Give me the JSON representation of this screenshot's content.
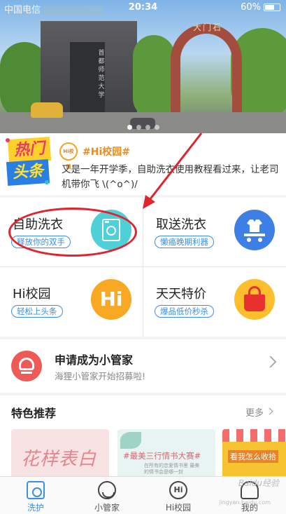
{
  "status_bar": {
    "carrier": "中国电信",
    "time": "20:34",
    "battery": "60%"
  },
  "banner": {
    "building_sign": "首都师范大学",
    "arch_sign": "大门石"
  },
  "news": {
    "badge_line1": "热门",
    "badge_line2": "头条",
    "logo_text": "Hi校园",
    "tag": "#Hi校园#",
    "text": "又是一年开学季，自助洗衣使用教程看过来，让老司机带你飞 \\(^o^)/"
  },
  "services": [
    {
      "title": "自助洗衣",
      "tag": "释放你的双手",
      "icon": "washing-machine-icon",
      "color": "#4fcfd8"
    },
    {
      "title": "取送洗衣",
      "tag": "懒癌晚期利器",
      "icon": "delivery-cart-icon",
      "color": "#3e7fe6"
    },
    {
      "title": "Hi校园",
      "tag": "轻松上头条",
      "icon": "hi-icon",
      "icon_text": "Hi",
      "color": "#f8a822"
    },
    {
      "title": "天天特价",
      "tag": "爆品低价秒杀",
      "icon": "shopping-bag-icon",
      "color": "#fbbe2d"
    }
  ],
  "recruit": {
    "title": "申请成为小管家",
    "subtitle": "海狸小管家开始招募啦!",
    "icon": "keeper-icon"
  },
  "featured": {
    "title": "特色推荐",
    "more": "更多",
    "cards": [
      {
        "text": "花样表白"
      },
      {
        "text": "#最美三行情书大赛#",
        "subtext": "在所有的恋爱情书里 最美的情书会是哪一封"
      },
      {
        "text": "看我怎么收拾"
      }
    ]
  },
  "tabbar": [
    {
      "label": "洗护",
      "icon": "washer-tab-icon",
      "active": true
    },
    {
      "label": "小管家",
      "icon": "keeper-tab-icon",
      "active": false
    },
    {
      "label": "Hi校园",
      "icon": "hi-tab-icon",
      "icon_text": "Hi",
      "active": false
    },
    {
      "label": "我的",
      "icon": "profile-tab-icon",
      "active": false
    }
  ],
  "watermark": {
    "line1": "Baidu经验",
    "line2": "jingyan.baidu.com"
  },
  "colors": {
    "accent": "#3d8fe0",
    "annotation": "#e0242c",
    "tag_orange": "#f08a17"
  }
}
